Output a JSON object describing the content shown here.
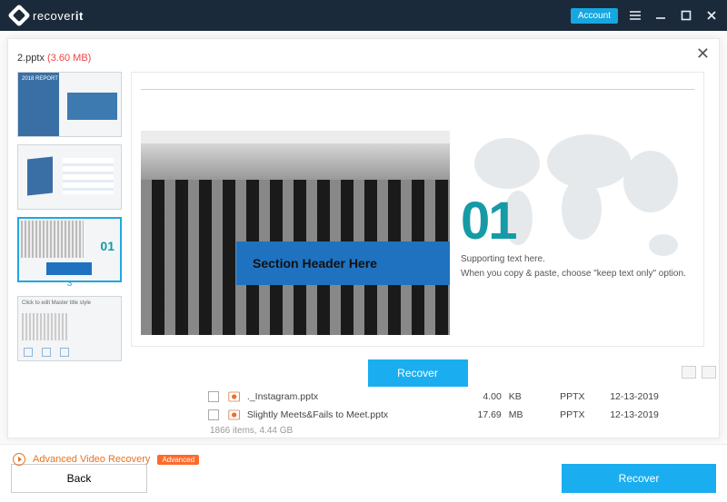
{
  "titlebar": {
    "brand_prefix": "recover",
    "brand_suffix": "it",
    "account_label": "Account"
  },
  "preview": {
    "filename": "2.pptx",
    "filesize": "(3.60 MB)",
    "selected_thumb_index": "3",
    "slide": {
      "section_title": "Section Header Here",
      "big_number": "01",
      "support1": "Supporting text here.",
      "support2": "When you copy & paste, choose \"keep text only\" option."
    },
    "recover_button": "Recover"
  },
  "filelist": {
    "rows": [
      {
        "name": "._Instagram.pptx",
        "size": "4.00",
        "unit": "KB",
        "type": "PPTX",
        "date": "12-13-2019"
      },
      {
        "name": "Slightly Meets&Fails to Meet.pptx",
        "size": "17.69",
        "unit": "MB",
        "type": "PPTX",
        "date": "12-13-2019"
      }
    ],
    "summary": "1866 items, 4.44  GB"
  },
  "footer": {
    "avr_label": "Advanced Video Recovery",
    "avr_badge": "Advanced",
    "back_label": "Back",
    "recover_label": "Recover"
  }
}
